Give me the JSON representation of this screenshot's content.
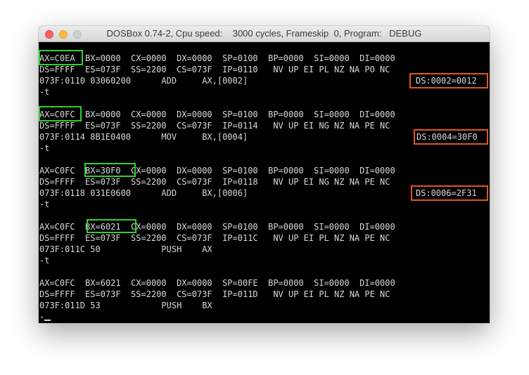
{
  "window": {
    "title": "DOSBox 0.74-2, Cpu speed:    3000 cycles, Frameskip  0, Program:   DEBUG"
  },
  "terminal": {
    "lines": [
      "AX=C0EA  BX=0000  CX=0000  DX=0000  SP=0100  BP=0000  SI=0000  DI=0000",
      "DS=FFFF  ES=073F  SS=2200  CS=073F  IP=0110   NV UP EI PL NZ NA PO NC",
      "073F:0110 03060200      ADD     AX,[0002]",
      "-t",
      "",
      "AX=C0FC  BX=0000  CX=0000  DX=0000  SP=0100  BP=0000  SI=0000  DI=0000",
      "DS=FFFF  ES=073F  SS=2200  CS=073F  IP=0114   NV UP EI NG NZ NA PE NC",
      "073F:0114 8B1E0400      MOV     BX,[0004]",
      "-t",
      "",
      "AX=C0FC  BX=30F0  CX=0000  DX=0000  SP=0100  BP=0000  SI=0000  DI=0000",
      "DS=FFFF  ES=073F  SS=2200  CS=073F  IP=0118   NV UP EI NG NZ NA PE NC",
      "073F:0118 031E0600      ADD     BX,[0006]",
      "-t",
      "",
      "AX=C0FC  BX=6021  CX=0000  DX=0000  SP=0100  BP=0000  SI=0000  DI=0000",
      "DS=FFFF  ES=073F  SS=2200  CS=073F  IP=011C   NV UP EI PL NZ NA PE NC",
      "073F:011C 50            PUSH    AX",
      "-t",
      "",
      "AX=C0FC  BX=6021  CX=0000  DX=0000  SP=00FE  BP=0000  SI=0000  DI=0000",
      "DS=FFFF  ES=073F  SS=2200  CS=073F  IP=011D   NV UP EI PL NZ NA PE NC",
      "073F:011D 53            PUSH    BX",
      "-"
    ],
    "annotations": [
      "DS:0002=0012",
      "DS:0004=30F0",
      "DS:0006=2F31"
    ]
  },
  "colors": {
    "highlight_register": "#2fd12f",
    "highlight_memory": "#e0561b",
    "terminal_bg": "#000000",
    "terminal_fg": "#d8d8d8"
  }
}
